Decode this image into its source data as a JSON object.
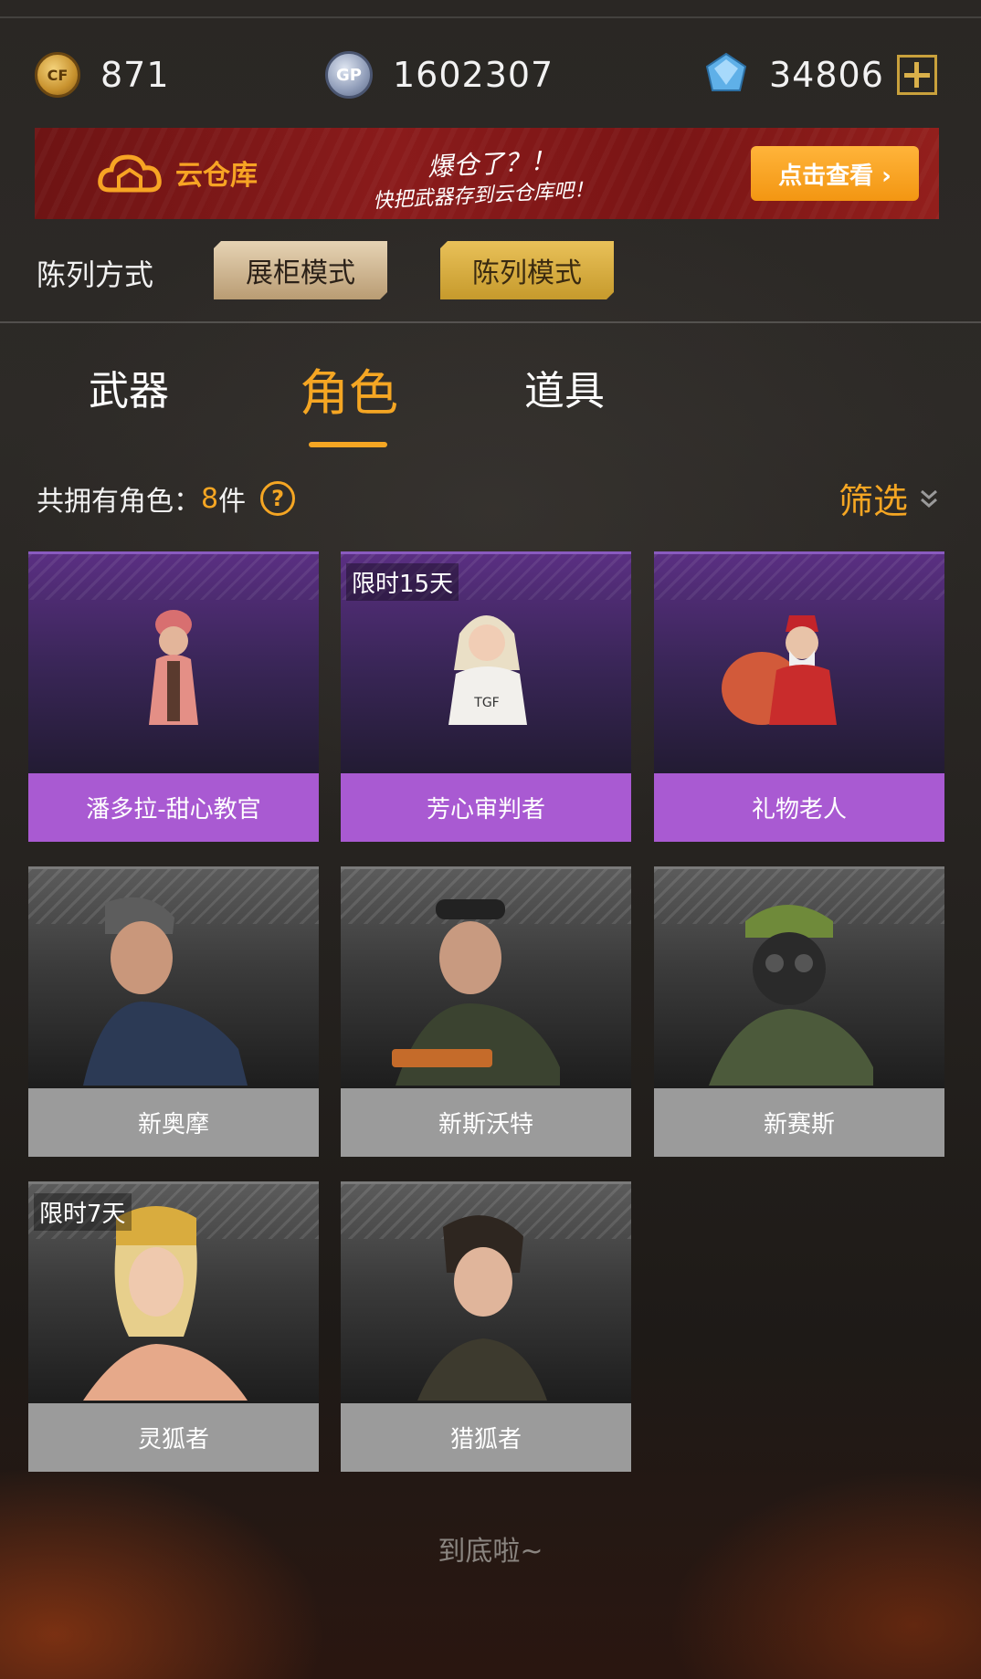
{
  "currencies": [
    {
      "icon": "cf-coin-icon",
      "amount": "871"
    },
    {
      "icon": "gp-coin-icon",
      "amount": "1602307"
    },
    {
      "icon": "diamond-icon",
      "amount": "34806"
    }
  ],
  "banner": {
    "title": "云仓库",
    "message_line1": "爆仓了？！",
    "message_line2": "快把武器存到云仓库吧！",
    "button": "点击查看 ›"
  },
  "arrangement": {
    "label": "陈列方式",
    "modes": [
      "展柜模式",
      "陈列模式"
    ],
    "selected": "陈列模式"
  },
  "tabs": [
    {
      "label": "武器",
      "active": false
    },
    {
      "label": "角色",
      "active": true
    },
    {
      "label": "道具",
      "active": false
    }
  ],
  "summary": {
    "prefix": "共拥有角色：",
    "count": "8",
    "unit": "件",
    "help": "?"
  },
  "filter": {
    "label": "筛选"
  },
  "characters": [
    {
      "name": "潘多拉-甜心教官",
      "rarity": "purple",
      "tag": ""
    },
    {
      "name": "芳心审判者",
      "rarity": "purple",
      "tag": "限时15天"
    },
    {
      "name": "礼物老人",
      "rarity": "purple",
      "tag": ""
    },
    {
      "name": "新奥摩",
      "rarity": "grey",
      "tag": ""
    },
    {
      "name": "新斯沃特",
      "rarity": "grey",
      "tag": ""
    },
    {
      "name": "新赛斯",
      "rarity": "grey",
      "tag": ""
    },
    {
      "name": "灵狐者",
      "rarity": "grey",
      "tag": "限时7天"
    },
    {
      "name": "猎狐者",
      "rarity": "grey",
      "tag": ""
    }
  ],
  "footer": {
    "end_text": "到底啦~"
  },
  "colors": {
    "accent": "#f5a623",
    "purple_card": "#a95ad2",
    "grey_card": "#9b9b9b",
    "banner_red": "#8a1b1b"
  }
}
